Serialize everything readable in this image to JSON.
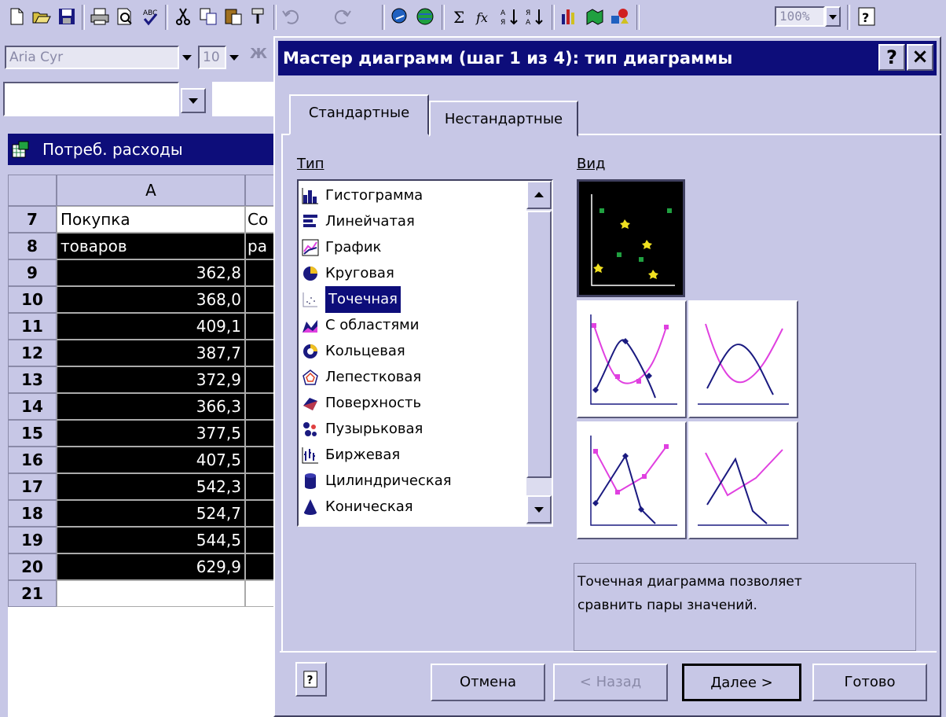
{
  "toolbar": {
    "icons": [
      "new-document-icon",
      "open-folder-icon",
      "save-icon",
      "print-icon",
      "print-preview-icon",
      "spellcheck-icon",
      "cut-icon",
      "copy-icon",
      "paste-icon",
      "format-painter-icon",
      "undo-icon",
      "redo-icon",
      "insert-hyperlink-icon",
      "web-toolbar-icon",
      "autosum-icon",
      "function-wizard-icon",
      "sort-ascending-icon",
      "sort-descending-icon",
      "chart-wizard-icon",
      "map-icon",
      "drawing-icon",
      "zoom-select",
      "office-assistant-icon"
    ],
    "zoom_value": "100%"
  },
  "formatting": {
    "font_name": "Aria Cyr",
    "font_size": "10",
    "bold_label": "Ж"
  },
  "namebox": {
    "value": ""
  },
  "sheet": {
    "window_title": "Потреб. расходы",
    "col_a": "A",
    "rows": [
      {
        "num": "7",
        "a": "Покупка",
        "b": "Со",
        "dark": false
      },
      {
        "num": "8",
        "a": "товаров",
        "b": "ра",
        "dark": true
      },
      {
        "num": "9",
        "a": "362,8",
        "b": "",
        "dark": true,
        "numeric": true
      },
      {
        "num": "10",
        "a": "368,0",
        "b": "",
        "dark": true,
        "numeric": true
      },
      {
        "num": "11",
        "a": "409,1",
        "b": "",
        "dark": true,
        "numeric": true
      },
      {
        "num": "12",
        "a": "387,7",
        "b": "",
        "dark": true,
        "numeric": true
      },
      {
        "num": "13",
        "a": "372,9",
        "b": "",
        "dark": true,
        "numeric": true
      },
      {
        "num": "14",
        "a": "366,3",
        "b": "",
        "dark": true,
        "numeric": true
      },
      {
        "num": "15",
        "a": "377,5",
        "b": "",
        "dark": true,
        "numeric": true
      },
      {
        "num": "16",
        "a": "407,5",
        "b": "",
        "dark": true,
        "numeric": true
      },
      {
        "num": "17",
        "a": "542,3",
        "b": "",
        "dark": true,
        "numeric": true
      },
      {
        "num": "18",
        "a": "524,7",
        "b": "",
        "dark": true,
        "numeric": true
      },
      {
        "num": "19",
        "a": "544,5",
        "b": "",
        "dark": true,
        "numeric": true
      },
      {
        "num": "20",
        "a": "629,9",
        "b": "",
        "dark": true,
        "numeric": true
      },
      {
        "num": "21",
        "a": "",
        "b": "",
        "dark": false
      }
    ]
  },
  "dialog": {
    "title": "Мастер диаграмм (шаг 1 из 4): тип диаграммы",
    "help_label": "?",
    "close_label": "×",
    "tabs": [
      {
        "label": "Стандартные",
        "active": true
      },
      {
        "label": "Нестандартные",
        "active": false
      }
    ],
    "type_label": "Тип",
    "view_label": "Вид",
    "chart_types": [
      {
        "label": "Гистограмма",
        "icon": "column-chart-icon"
      },
      {
        "label": "Линейчатая",
        "icon": "bar-chart-icon"
      },
      {
        "label": "График",
        "icon": "line-chart-icon"
      },
      {
        "label": "Круговая",
        "icon": "pie-chart-icon"
      },
      {
        "label": "Точечная",
        "icon": "scatter-chart-icon",
        "selected": true
      },
      {
        "label": "С областями",
        "icon": "area-chart-icon"
      },
      {
        "label": "Кольцевая",
        "icon": "doughnut-chart-icon"
      },
      {
        "label": "Лепестковая",
        "icon": "radar-chart-icon"
      },
      {
        "label": "Поверхность",
        "icon": "surface-chart-icon"
      },
      {
        "label": "Пузырьковая",
        "icon": "bubble-chart-icon"
      },
      {
        "label": "Биржевая",
        "icon": "stock-chart-icon"
      },
      {
        "label": "Цилиндрическая",
        "icon": "cylinder-chart-icon"
      },
      {
        "label": "Коническая",
        "icon": "cone-chart-icon"
      }
    ],
    "subtypes": [
      {
        "name": "scatter-markers",
        "selected": true
      },
      {
        "name": "scatter-smooth-markers"
      },
      {
        "name": "scatter-smooth-lines"
      },
      {
        "name": "scatter-straight-markers"
      },
      {
        "name": "scatter-straight-lines"
      }
    ],
    "description": [
      "Точечная диаграмма позволяет",
      "сравнить пары значений."
    ],
    "buttons": {
      "cancel": "Отмена",
      "back": "< Назад",
      "next": "Далее >",
      "finish": "Готово"
    }
  },
  "colors": {
    "title_bar": "#0d0d7a",
    "chrome": "#c7c7e6",
    "marker_pink": "#e040e0",
    "marker_navy": "#1a1a80"
  }
}
